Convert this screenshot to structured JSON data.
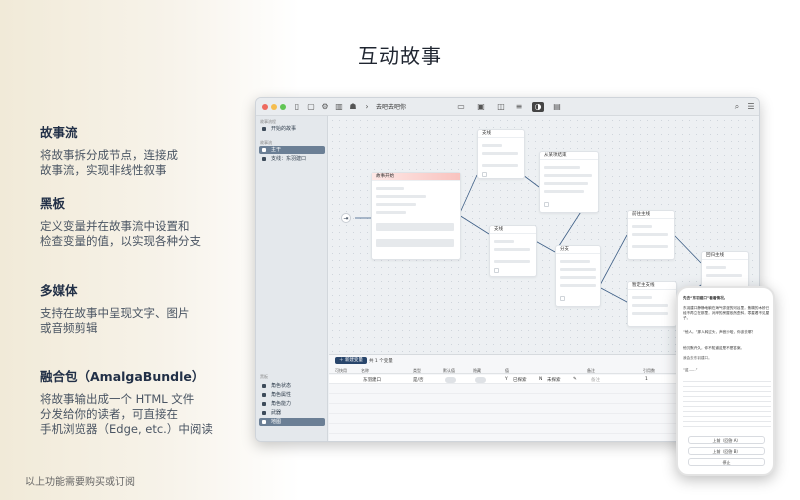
{
  "heading": "互动故事",
  "features": [
    {
      "title": "故事流",
      "desc": "将故事拆分成节点，连接成\n故事流，实现非线性叙事"
    },
    {
      "title": "黑板",
      "desc": "定义变量并在故事流中设置和\n检查变量的值，以实现各种分支"
    },
    {
      "title": "多媒体",
      "desc": "支持在故事中呈现文字、图片\n或音频剪辑"
    },
    {
      "title": "融合包（AmalgaBundle）",
      "desc": "将故事输出成一个 HTML 文件\n分发给你的读者，可直接在\n手机浏览器（Edge, etc.）中阅读"
    }
  ],
  "footnote": "以上功能需要购买或订阅",
  "app": {
    "title": "去吧去吧你",
    "sidebar": {
      "section_story": "故事流程",
      "story_item": "开始的故事",
      "section_nodes": "故事流",
      "items": [
        "主干",
        "支线：东羽建口"
      ],
      "section_bb": "黑板",
      "bb_items": [
        "角色状态",
        "角色属性",
        "角色能力",
        "武器",
        "地图"
      ]
    },
    "nodes": {
      "start": "故事开始",
      "branch1": "支线",
      "branch2": "支线",
      "from_result": "从某项结束",
      "branch3": "分支",
      "go_mainline": "前往主线",
      "return_main": "回归主线",
      "backup": "暂定主支线"
    },
    "bottom": {
      "add_button": "新建变量",
      "count": "共 1 个变量",
      "headers": [
        "可快用",
        "名称",
        "类型",
        "默认值",
        "隐藏",
        "值",
        "",
        "",
        "备注",
        "引用数"
      ],
      "row": {
        "name": "东羽建口",
        "type": "是/否",
        "val_y": "Y",
        "val_y_label": "已探索",
        "val_n": "N",
        "val_n_label": "未探索",
        "note": "备注",
        "refs": "1"
      }
    }
  },
  "phone": {
    "p1": "先去“东羽建口”看看情况。",
    "p2": "东羽建口静静地躺在海气弥漫的河谷里，焦糊的木桥已经不再立在那里，对岸的房屋依然歪斜，零星看不见屋子。",
    "p3": "“他人。”那人转过头，声音沙哑，你该去哪？",
    "p4": "他沉默许久，你不知道这是不是答案。",
    "p5": "“这……”",
    "btn1": "上前（回答 A）",
    "btn2": "上前（回答 B）",
    "btn3": "停止",
    "choice": "我会去东羽建口。"
  }
}
